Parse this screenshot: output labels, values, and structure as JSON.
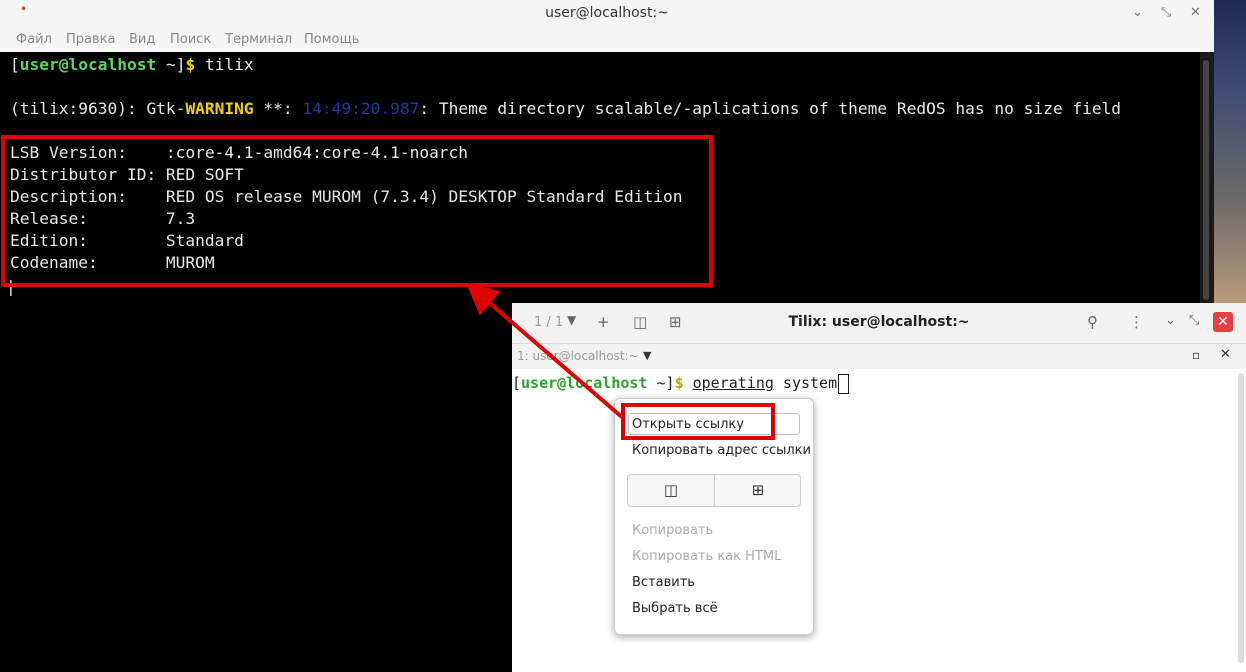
{
  "outer_window": {
    "title": "user@localhost:~",
    "menu": [
      "Файл",
      "Правка",
      "Вид",
      "Поиск",
      "Терминал",
      "Помощь"
    ]
  },
  "terminal": {
    "prompt_open": "[",
    "prompt_user": "user@localhost",
    "prompt_tail": " ~]",
    "prompt_dollar": "$",
    "command": " tilix",
    "warning_prefix": "(tilix:9630): Gtk-",
    "warning_word": "WARNING",
    "warning_stars": " **: ",
    "warning_time": "14:49:20.987",
    "warning_msg": ": Theme directory scalable/-aplications of theme RedOS has no size field",
    "lsb_lines": [
      "LSB Version:    :core-4.1-amd64:core-4.1-noarch",
      "Distributor ID: RED SOFT",
      "Description:    RED OS release MUROM (7.3.4) DESKTOP Standard Edition",
      "Release:        7.3",
      "Edition:        Standard",
      "Codename:       MUROM"
    ],
    "cursor_char": "|"
  },
  "tilix": {
    "title": "Tilix: user@localhost:~",
    "counter": "1 / 1",
    "session_label": "1: user@localhost:~",
    "prompt_open": "[",
    "prompt_user": "user@localhost",
    "prompt_tail": " ~]",
    "prompt_dollar": "$",
    "typed_link": "operating",
    "typed_rest": " system"
  },
  "context_menu": {
    "open_link": "Открыть ссылку",
    "copy_link": "Копировать адрес ссылки",
    "copy": "Копировать",
    "copy_html": "Копировать как HTML",
    "paste": "Вставить",
    "select_all": "Выбрать всё"
  },
  "colors": {
    "annotation_red": "#e00000",
    "prompt_green": "#5fd75f",
    "warning_yellow": "#f0d000"
  }
}
